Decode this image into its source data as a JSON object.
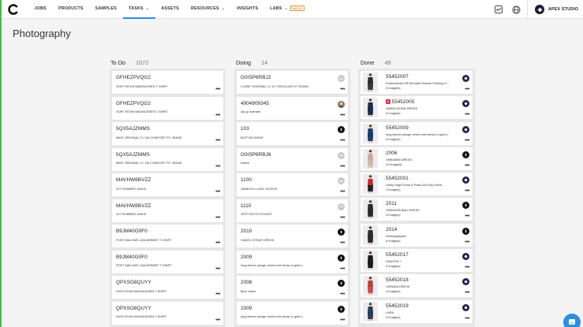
{
  "brand": {
    "logo": "c-logo-icon"
  },
  "nav": {
    "items": [
      {
        "label": "JOBS",
        "dropdown": false,
        "active": false
      },
      {
        "label": "PRODUCTS",
        "dropdown": false,
        "active": false
      },
      {
        "label": "SAMPLES",
        "dropdown": false,
        "active": false
      },
      {
        "label": "TASKS",
        "dropdown": true,
        "active": true
      },
      {
        "label": "ASSETS",
        "dropdown": false,
        "active": false
      },
      {
        "label": "RESOURCES",
        "dropdown": true,
        "active": false
      },
      {
        "label": "INSIGHTS",
        "dropdown": false,
        "active": false
      },
      {
        "label": "LABS",
        "dropdown": true,
        "active": false,
        "badge": "BETA"
      }
    ]
  },
  "header": {
    "studio": "APEX STUDIO",
    "icons": [
      "chart-icon",
      "globe-icon"
    ]
  },
  "page": {
    "title": "Photography"
  },
  "colors": {
    "accent": "#2a8fd8",
    "left_border": "#3fc13f",
    "beta": "#e08a2a",
    "flag": "#e0304a",
    "chat": "#2a8fe0"
  },
  "columns": {
    "todo": {
      "label": "To Do",
      "count": "1072",
      "cards": [
        {
          "title": "GFHEZPVQG2",
          "sub": "SORT KEVIN MAGNUSSEN T-SHIRT"
        },
        {
          "title": "GFHEZPVQG2",
          "sub": "SORT KEVIN MAGNUSSEN T-SHIRT"
        },
        {
          "title": "5QX5AJZMMS",
          "sub": "MIKE ORIGINAL CJ 118 COMFORT FIT JEANS"
        },
        {
          "title": "5QX5AJZMMS",
          "sub": "MIKE ORIGINAL CJ 118 COMFORT FIT JEANS"
        },
        {
          "title": "MAVHW8BVZZ",
          "sub": "LET BOMBER JAKKE"
        },
        {
          "title": "MAVHW8BVZZ",
          "sub": "LET BOMBER JAKKE"
        },
        {
          "title": "B9JM40G0F0",
          "sub": "POST MALONE LANGÆRMET T-SHIRT"
        },
        {
          "title": "B9JM40G0F0",
          "sub": "POST MALONE LANGÆRMET T-SHIRT"
        },
        {
          "title": "QPXSO8QUYY",
          "sub": "HVID KEVIN MAGNUSSEN T-SHIRT"
        },
        {
          "title": "QPXSO8QUYY",
          "sub": "HVID KEVIN MAGNUSSEN T-SHIRT"
        }
      ]
    },
    "doing": {
      "label": "Doing",
      "count": "14",
      "cards": [
        {
          "title": "G0ISP6RBJ2",
          "sub": "CLARK ORIGINAL CJ 117 REGULAR FIT JEANS",
          "avatar": "grey",
          "initials": "DB"
        },
        {
          "title": "4904909345",
          "sub": "zip-up sweater",
          "avatar": "photo",
          "initials": ""
        },
        {
          "title": "103",
          "sub": "BUTTON WRAP",
          "avatar": "dark",
          "initials": ""
        },
        {
          "title": "G0ISP6RBJ6",
          "sub": "Noemi",
          "avatar": "grey",
          "initials": "DB"
        },
        {
          "title": "1100",
          "sub": "JAMELKO LONG SLEEVE",
          "avatar": "grey",
          "initials": "DB"
        },
        {
          "title": "1110",
          "sub": "JEFF PATCH POCKET",
          "avatar": "grey",
          "initials": "DB"
        },
        {
          "title": "2010",
          "sub": "VIADEL STRAP DRESS",
          "avatar": "dark",
          "initials": ""
        },
        {
          "title": "2009",
          "sub": "long sleeve plunge velvet mini dress in gold s...",
          "avatar": "dark",
          "initials": ""
        },
        {
          "title": "2008",
          "sub": "Blue Jeans",
          "avatar": "dark",
          "initials": ""
        },
        {
          "title": "2009",
          "sub": "long sleeve plunge velvet mini dress in gold s...",
          "avatar": "dark",
          "initials": ""
        }
      ]
    },
    "done": {
      "label": "Done",
      "count": "49",
      "cards": [
        {
          "title": "55452007",
          "sub": "Embroidered Off Shoulder Illusion Evening G...",
          "meta": "5 Image(s)",
          "flag": false,
          "avatar": "navy",
          "outfit": [
            "#2b2b2b",
            "#3a3a3a"
          ]
        },
        {
          "title": "55452005",
          "sub": "AMIRA GENNI DRESS",
          "meta": "5 Image(s)",
          "flag": true,
          "avatar": "navy",
          "outfit": [
            "#1f2a4a",
            "#1f2a4a"
          ]
        },
        {
          "title": "55452009",
          "sub": "long sleeve plunge velvet mini dress in gold s...",
          "meta": "5 Image(s)",
          "flag": false,
          "avatar": "navy",
          "outfit": [
            "#1c3a6a",
            "#1c3a6a"
          ]
        },
        {
          "title": "2006",
          "sub": "VMKAMMI DRESS",
          "meta": "11 Image(s)",
          "flag": false,
          "avatar": "dark",
          "outfit": [
            "#c9a7a0",
            "#d8b4ae"
          ]
        },
        {
          "title": "55452001",
          "sub": "Likely Sage Floral & Polka Dot Slip Dress",
          "meta": "4 Image(s)",
          "flag": false,
          "avatar": "navy",
          "outfit": [
            "#c42a2a",
            "#222222"
          ]
        },
        {
          "title": "2011",
          "sub": "VMSASHA BALI DRESS",
          "meta": "5 Image(s)",
          "flag": false,
          "avatar": "dark",
          "outfit": [
            "#2a2a2a",
            "#2a2a2a"
          ]
        },
        {
          "title": "2014",
          "sub": "Hverdagskjoler",
          "meta": "6 Image(s)",
          "flag": false,
          "avatar": "dark",
          "outfit": [
            "#2c2c2c",
            "#2c2c2c"
          ]
        },
        {
          "title": "55452017",
          "sub": "DANCER-I",
          "meta": "4 Image(s)",
          "flag": false,
          "avatar": "navy",
          "outfit": [
            "#1a1a1a",
            "#1a1a1a"
          ]
        },
        {
          "title": "55452018",
          "sub": "VMGAVA DRESS",
          "meta": "4 Image(s)",
          "flag": false,
          "avatar": "navy",
          "outfit": [
            "#b8403a",
            "#c9504a"
          ]
        },
        {
          "title": "55452019",
          "sub": "LARA",
          "meta": "9 Image(s)",
          "flag": false,
          "avatar": "navy",
          "outfit": [
            "#2a3a5a",
            "#2a3a5a"
          ]
        }
      ]
    }
  }
}
